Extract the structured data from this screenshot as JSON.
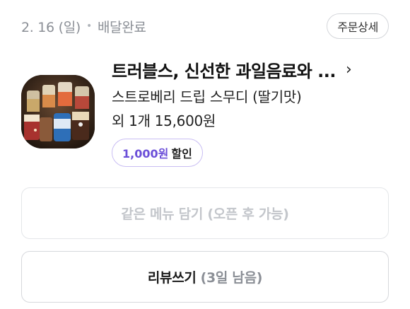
{
  "order": {
    "date": "2. 16 (일)",
    "separator": "•",
    "status": "배달완료",
    "detail_button": "주문상세"
  },
  "store": {
    "name": "트러블스, 신선한 과일음료와 ...",
    "chevron_icon": "chevron-right-icon",
    "menu": "스트로베리 드립 스무디 (딸기맛)",
    "quantity_price": "외 1개 15,600원",
    "discount_amount": "1,000원",
    "discount_label": "할인"
  },
  "actions": {
    "reorder_label": "같은 메뉴 담기 (오픈 후 가능)",
    "review_label": "리뷰쓰기",
    "review_remaining": "(3일 남음)"
  },
  "colors": {
    "accent_purple": "#6b4fd8",
    "muted_text": "#8b8f96",
    "disabled_text": "#c3c6cb"
  }
}
